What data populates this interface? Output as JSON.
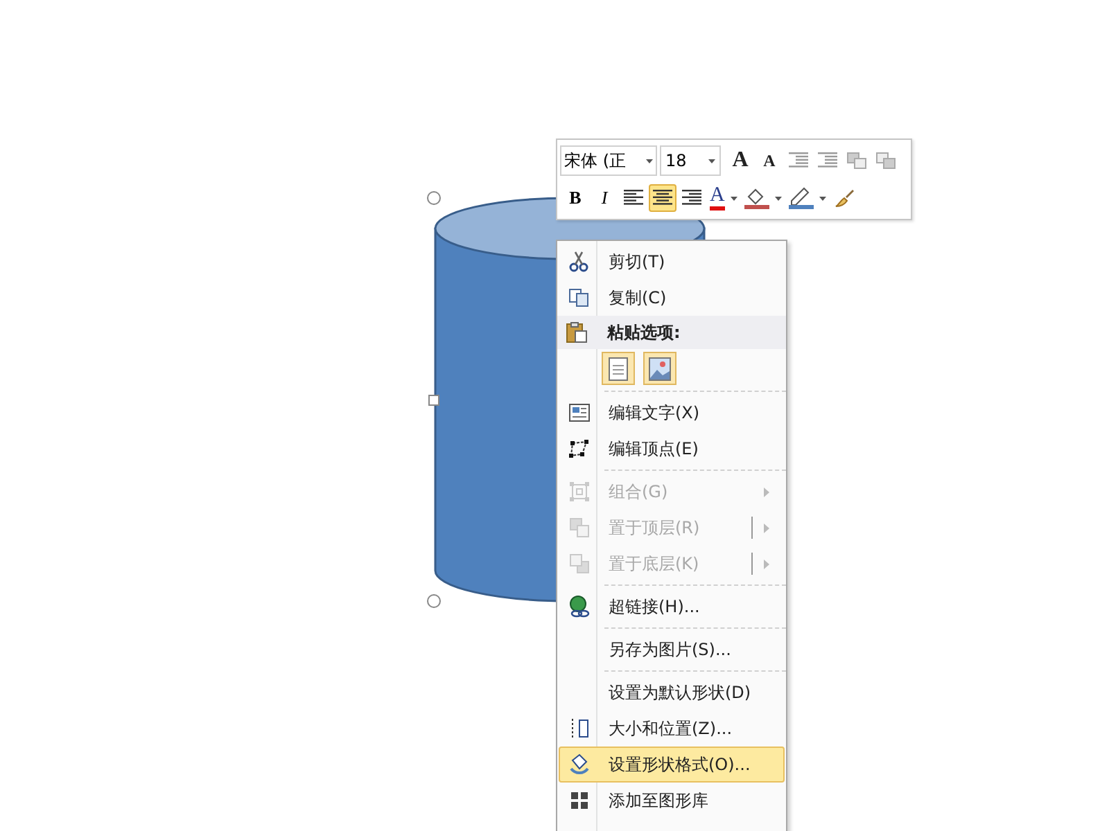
{
  "mini_toolbar": {
    "font_name": "宋体 (正",
    "font_size": "18",
    "row1": [
      {
        "kind": "grow",
        "label": "A"
      },
      {
        "kind": "shrink",
        "label": "A"
      },
      {
        "kind": "outdent"
      },
      {
        "kind": "indent"
      },
      {
        "kind": "front"
      },
      {
        "kind": "back"
      }
    ],
    "row2": [
      {
        "kind": "bold",
        "label": "B"
      },
      {
        "kind": "italic",
        "label": "I"
      },
      {
        "kind": "align-left",
        "selected": false
      },
      {
        "kind": "align-center",
        "selected": true
      },
      {
        "kind": "align-right",
        "selected": false
      },
      {
        "kind": "font-color",
        "label": "A"
      },
      {
        "kind": "fill-color"
      },
      {
        "kind": "line-color"
      },
      {
        "kind": "format-painter"
      }
    ]
  },
  "context_menu": [
    {
      "kind": "item",
      "label": "剪切(T)",
      "disabled": false,
      "selected": false
    },
    {
      "kind": "item",
      "label": "复制(C)",
      "disabled": false,
      "selected": false
    },
    {
      "kind": "header",
      "label": "粘贴选项:"
    },
    {
      "kind": "paste-options"
    },
    {
      "kind": "separator"
    },
    {
      "kind": "item",
      "label": "编辑文字(X)",
      "disabled": false,
      "selected": false
    },
    {
      "kind": "item",
      "label": "编辑顶点(E)",
      "disabled": false,
      "selected": false
    },
    {
      "kind": "separator"
    },
    {
      "kind": "submenu",
      "label": "组合(G)",
      "disabled": true,
      "selected": false
    },
    {
      "kind": "split",
      "label": "置于顶层(R)",
      "disabled": true,
      "selected": false
    },
    {
      "kind": "split",
      "label": "置于底层(K)",
      "disabled": true,
      "selected": false
    },
    {
      "kind": "separator"
    },
    {
      "kind": "item",
      "label": "超链接(H)...",
      "disabled": false,
      "selected": false
    },
    {
      "kind": "separator"
    },
    {
      "kind": "item",
      "label": "另存为图片(S)...",
      "disabled": false,
      "selected": false
    },
    {
      "kind": "separator"
    },
    {
      "kind": "item",
      "label": "设置为默认形状(D)",
      "disabled": false,
      "selected": false
    },
    {
      "kind": "item",
      "label": "大小和位置(Z)...",
      "disabled": false,
      "selected": false
    },
    {
      "kind": "item",
      "label": "设置形状格式(O)...",
      "disabled": false,
      "selected": true
    },
    {
      "kind": "item",
      "label": "添加至图形库",
      "disabled": false,
      "selected": false
    }
  ]
}
